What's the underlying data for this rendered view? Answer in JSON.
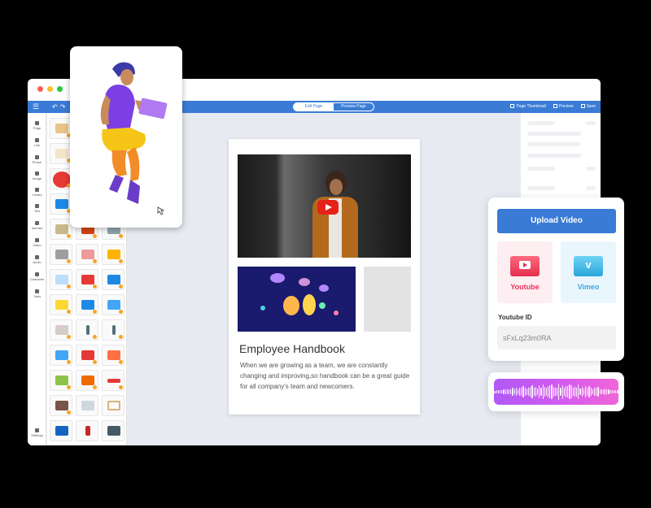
{
  "window": {
    "traffic_colors": [
      "#ff5f57",
      "#febc2e",
      "#28c840"
    ]
  },
  "toolbar": {
    "edit_page": "Edit Page",
    "preview_page": "Preview Page",
    "page_thumbnail": "Page Thumbnail",
    "preview": "Preview",
    "save": "Save"
  },
  "rail": [
    "Page",
    "Link",
    "Phone",
    "Image",
    "Library",
    "Text",
    "Interact",
    "Video",
    "Audio",
    "Character",
    "Tools",
    "Settings"
  ],
  "page": {
    "title": "Employee Handbook",
    "text": "When we are growing as a team, we are constantly changing and improving,so handbook can be a great guide for all company's team and newcomers."
  },
  "upload": {
    "button": "Upload Video",
    "youtube_label": "Youtube",
    "vimeo_label": "Vimeo",
    "id_label": "Youtube ID",
    "id_value": "sFxLq23m0RA"
  },
  "colors": {
    "accent": "#3a7bd5",
    "youtube": "#f04a6b",
    "vimeo": "#4ab8e8"
  }
}
